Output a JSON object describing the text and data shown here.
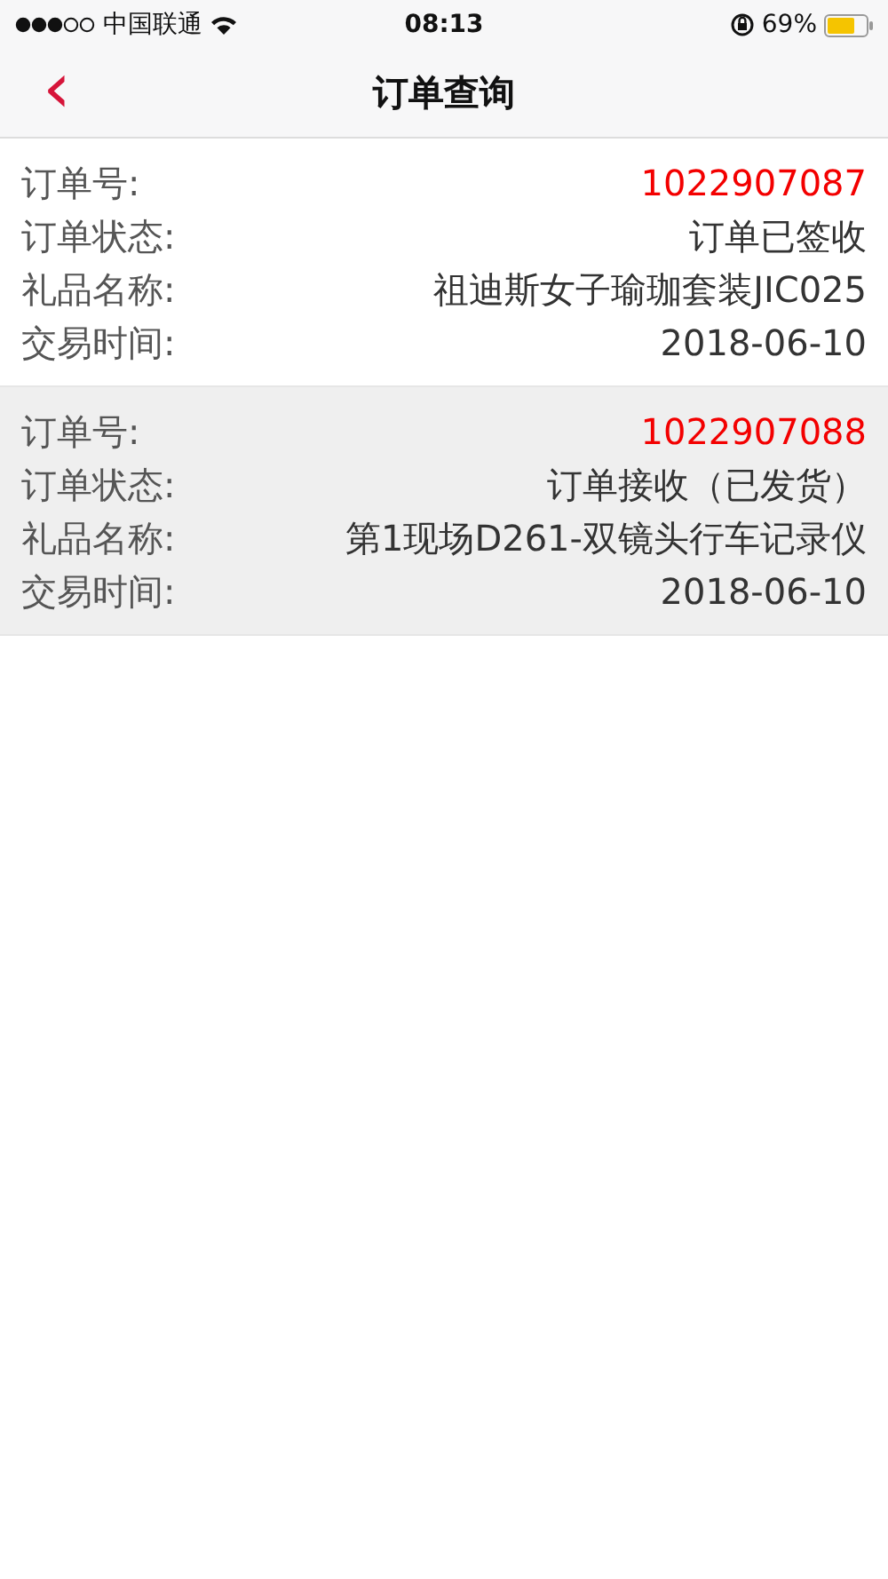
{
  "status_bar": {
    "carrier": "中国联通",
    "time": "08:13",
    "battery": "69%"
  },
  "nav": {
    "back": "‹",
    "title": "订单查询"
  },
  "orders": [
    {
      "selected": false,
      "fields": [
        {
          "label": "订单号:",
          "value": "1022907087",
          "kind": "number"
        },
        {
          "label": "订单状态:",
          "value": "订单已签收",
          "kind": "text"
        },
        {
          "label": "礼品名称:",
          "value": "祖迪斯女子瑜珈套装JIC025",
          "kind": "text"
        },
        {
          "label": "交易时间:",
          "value": "2018-06-10",
          "kind": "text"
        }
      ]
    },
    {
      "selected": true,
      "fields": [
        {
          "label": "订单号:",
          "value": "1022907088",
          "kind": "number"
        },
        {
          "label": "订单状态:",
          "value": "订单接收（已发货）",
          "kind": "text"
        },
        {
          "label": "礼品名称:",
          "value": "第1现场D261-双镜头行车记录仪",
          "kind": "text"
        },
        {
          "label": "交易时间:",
          "value": "2018-06-10",
          "kind": "text"
        }
      ]
    }
  ]
}
